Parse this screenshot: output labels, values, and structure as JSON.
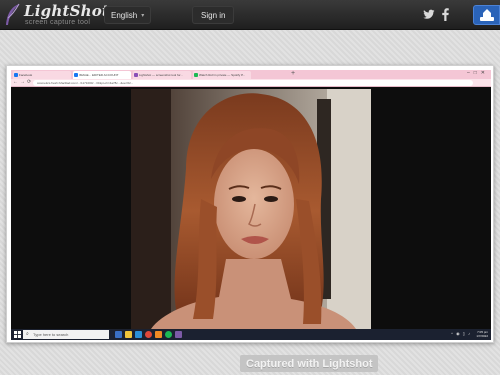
{
  "header": {
    "logo_title": "LightShot",
    "logo_subtitle": "screen capture tool",
    "language_label": "English",
    "signin_label": "Sign in"
  },
  "icons": {
    "logo": "feather-icon",
    "language_dropdown": "chevron-down-icon",
    "twitter": "twitter-icon",
    "facebook": "facebook-icon",
    "download": "download-icon"
  },
  "screenshot": {
    "browser_tabs": [
      {
        "label": "Facebook",
        "favicon_color": "#1877f2"
      },
      {
        "label": "IMAGE... EDITED ACCOUNT",
        "favicon_color": "#1877f2"
      },
      {
        "label": "Lightshot — screenshot tool for...",
        "favicon_color": "#8a4fb7"
      },
      {
        "label": "Watch Roll in private — Spotify P...",
        "favicon_color": "#1db954"
      }
    ],
    "address_url": "cosmetics.fresh.fxfaciliad.com/.../1171000/...=0&pt.oh=4a78c...&oe=62..."
  },
  "taskbar": {
    "search_placeholder": "Type here to search",
    "clock_time": "7:05 pm",
    "clock_date": "1/7/2022"
  },
  "colors": {
    "accent_blue": "#2a63b8",
    "browser_tab_pink": "#f4c6d5",
    "topbar_dark": "#2a2a2a"
  },
  "footer": {
    "caption": "Captured with Lightshot"
  }
}
